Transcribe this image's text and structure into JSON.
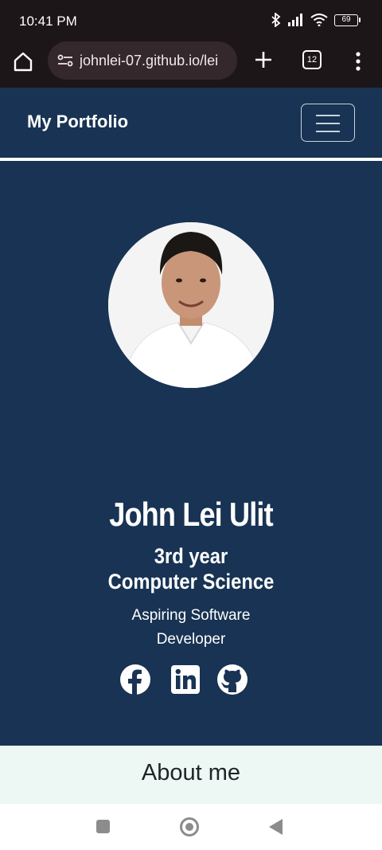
{
  "status_bar": {
    "time": "10:41 PM",
    "battery": "69"
  },
  "browser": {
    "url": "johnlei-07.github.io/lei",
    "tab_count": "12"
  },
  "site": {
    "brand": "My Portfolio",
    "name": "John Lei Ulit",
    "subtitle": "3rd year Computer Science",
    "tagline": "Aspiring Software Developer",
    "socials": [
      "facebook-icon",
      "linkedin-icon",
      "github-icon"
    ],
    "about_title": "About me"
  },
  "colors": {
    "page_bg": "#183353",
    "about_bg": "#edf7f4",
    "text": "#ffffff"
  }
}
